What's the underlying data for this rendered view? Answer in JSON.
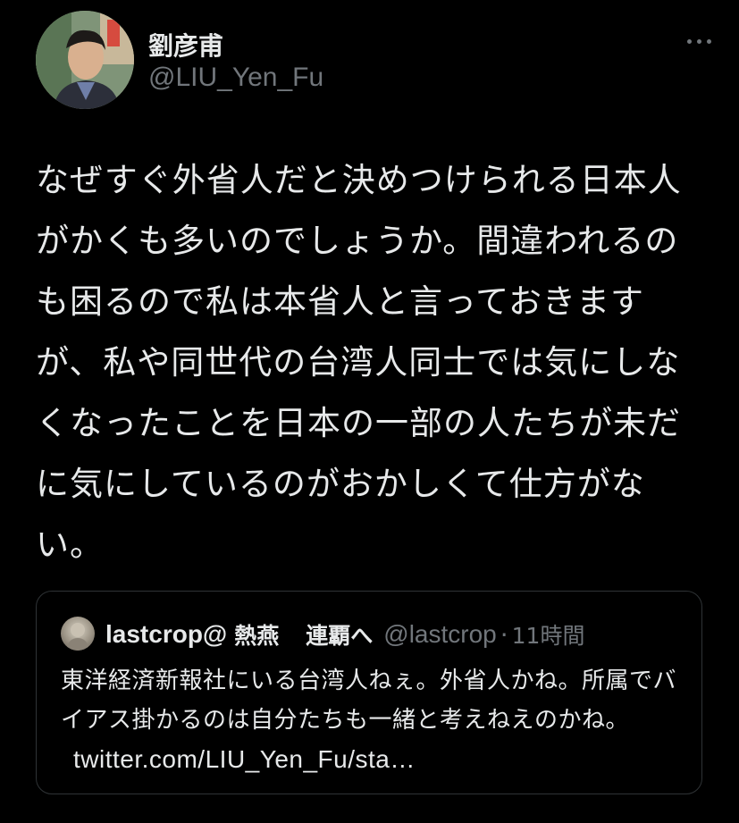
{
  "tweet": {
    "author": {
      "display_name": "劉彦甫",
      "handle": "@LIU_Yen_Fu"
    },
    "more_icon": "more-horizontal-icon",
    "text": "なぜすぐ外省人だと決めつけられる日本人がかくも多いのでしょうか。間違われるのも困るので私は本省人と言っておきますが、私や同世代の台湾人同士では気にしなくなったことを日本の一部の人たちが未だに気にしているのがおかしくて仕方がない。"
  },
  "quote": {
    "author": {
      "name": "lastcrop@",
      "name_part2": "熱燕",
      "name_part3": "連覇へ",
      "handle": "@lastcrop",
      "separator": "·",
      "time": "11時間"
    },
    "text": "東洋経済新報社にいる台湾人ねぇ。外省人かね。所属でバイアス掛かるのは自分たちも一緒と考えねえのかね。",
    "link": "twitter.com/LIU_Yen_Fu/sta…"
  },
  "colors": {
    "background": "#000000",
    "primary_text": "#e7e9ea",
    "secondary_text": "#71767b",
    "border": "#2f3336"
  }
}
